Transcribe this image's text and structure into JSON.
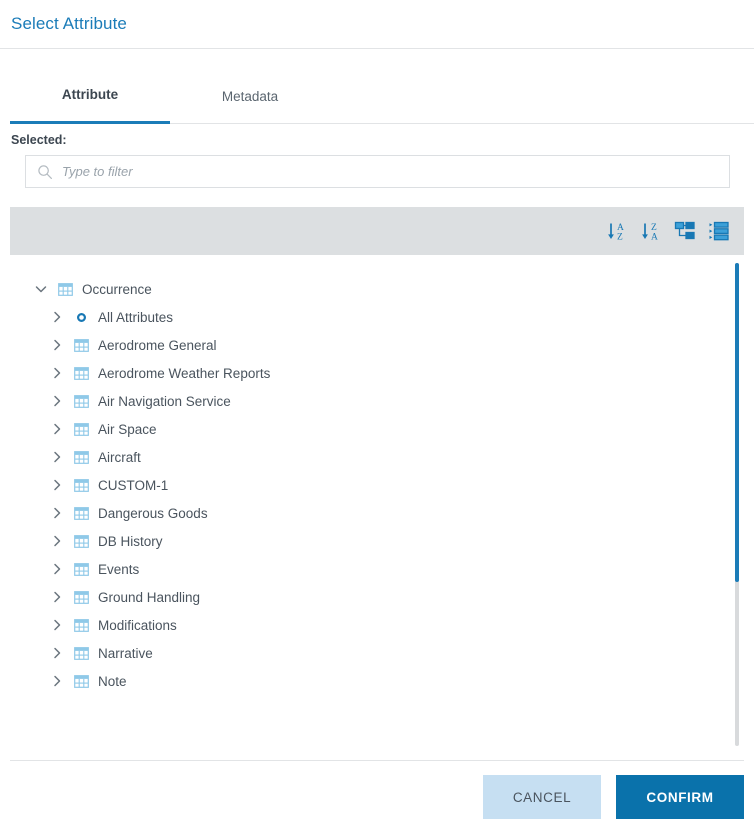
{
  "header": {
    "title": "Select Attribute"
  },
  "tabs": [
    {
      "label": "Attribute",
      "active": true
    },
    {
      "label": "Metadata",
      "active": false
    }
  ],
  "selected": {
    "label": "Selected:",
    "value": ""
  },
  "filter": {
    "placeholder": "Type to filter",
    "value": "",
    "icon": "search-icon"
  },
  "toolbar": {
    "buttons": [
      {
        "name": "sort-az-button",
        "icon": "sort-ascending-alpha-icon",
        "label": "A Z"
      },
      {
        "name": "sort-za-button",
        "icon": "sort-descending-alpha-icon",
        "label": "Z A"
      },
      {
        "name": "tree-view-button",
        "icon": "hierarchy-tree-icon",
        "label": ""
      },
      {
        "name": "list-view-button",
        "icon": "flat-list-icon",
        "label": ""
      }
    ]
  },
  "tree": {
    "root": {
      "label": "Occurrence",
      "icon": "table-icon",
      "expanded": true,
      "twisty": "chevron-down-icon"
    },
    "children": [
      {
        "label": "All Attributes",
        "icon": "circle-dot-icon",
        "twisty": "chevron-right-icon"
      },
      {
        "label": "Aerodrome General",
        "icon": "table-icon",
        "twisty": "chevron-right-icon"
      },
      {
        "label": "Aerodrome Weather Reports",
        "icon": "table-icon",
        "twisty": "chevron-right-icon"
      },
      {
        "label": "Air Navigation Service",
        "icon": "table-icon",
        "twisty": "chevron-right-icon"
      },
      {
        "label": "Air Space",
        "icon": "table-icon",
        "twisty": "chevron-right-icon"
      },
      {
        "label": "Aircraft",
        "icon": "table-icon",
        "twisty": "chevron-right-icon"
      },
      {
        "label": "CUSTOM-1",
        "icon": "table-icon",
        "twisty": "chevron-right-icon"
      },
      {
        "label": "Dangerous Goods",
        "icon": "table-icon",
        "twisty": "chevron-right-icon"
      },
      {
        "label": "DB History",
        "icon": "table-icon",
        "twisty": "chevron-right-icon"
      },
      {
        "label": "Events",
        "icon": "table-icon",
        "twisty": "chevron-right-icon"
      },
      {
        "label": "Ground Handling",
        "icon": "table-icon",
        "twisty": "chevron-right-icon"
      },
      {
        "label": "Modifications",
        "icon": "table-icon",
        "twisty": "chevron-right-icon"
      },
      {
        "label": "Narrative",
        "icon": "table-icon",
        "twisty": "chevron-right-icon"
      },
      {
        "label": "Note",
        "icon": "table-icon",
        "twisty": "chevron-right-icon"
      }
    ]
  },
  "footer": {
    "cancel_label": "CANCEL",
    "confirm_label": "CONFIRM"
  },
  "colors": {
    "accent": "#1b7cb8",
    "confirm_bg": "#0a72ab",
    "cancel_bg": "#c6dff2",
    "toolbar_bg": "#dcdfe1",
    "text": "#3c4650",
    "icon_light_blue": "#8fc9e8"
  }
}
